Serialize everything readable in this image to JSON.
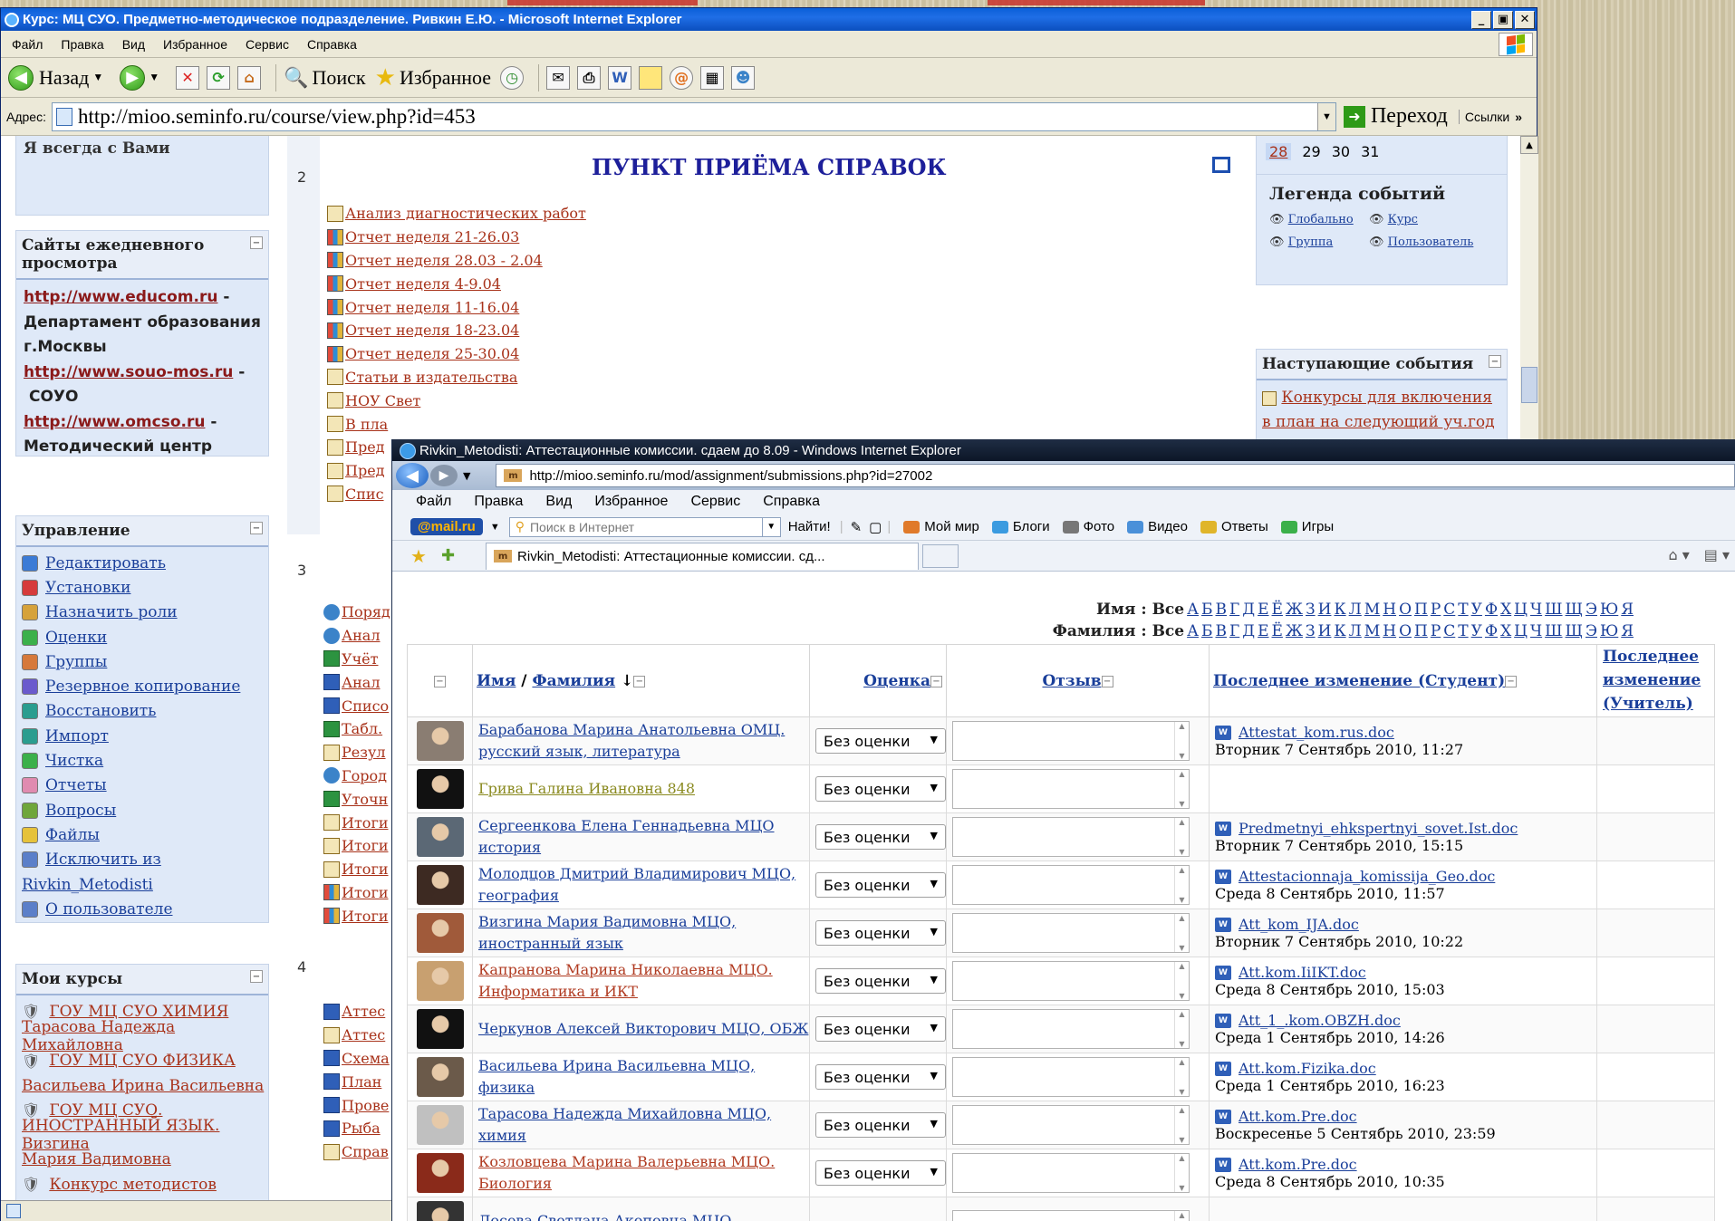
{
  "w1": {
    "title": "Курс: МЦ СУО. Предметно-методическое подразделение. Ривкин Е.Ю. - Microsoft Internet Explorer",
    "menu": [
      "Файл",
      "Правка",
      "Вид",
      "Избранное",
      "Сервис",
      "Справка"
    ],
    "toolbar": {
      "back": "Назад",
      "search": "Поиск",
      "favorites": "Избранное"
    },
    "address": {
      "label": "Адрес:",
      "url": "http://mioo.seminfo.ru/course/view.php?id=453",
      "go": "Переход",
      "links": "Ссылки"
    }
  },
  "left": {
    "always": "Я всегда с Вами",
    "sites": {
      "title": "Сайты ежедневного просмотра",
      "items": [
        {
          "link": "http://www.educom.ru",
          "suffix": " -"
        },
        {
          "text": "Департамент образования г.Москвы"
        },
        {
          "link": "http://www.souo-mos.ru",
          "suffix": " -"
        },
        {
          "text": "СОУО"
        },
        {
          "link": "http://www.omcso.ru",
          "suffix": " -"
        },
        {
          "text": "Методический центр"
        }
      ]
    },
    "admin": {
      "title": "Управление",
      "items": [
        "Редактировать",
        "Установки",
        "Назначить роли",
        "Оценки",
        "Группы",
        "Резервное копирование",
        "Восстановить",
        "Импорт",
        "Чистка",
        "Отчеты",
        "Вопросы",
        "Файлы",
        "Исключить из",
        "Rivkin_Metodisti",
        "О пользователе"
      ],
      "icon_colors": [
        "#3b7bd6",
        "#d63b3b",
        "#d6a23b",
        "#3bb04a",
        "#d6793b",
        "#6a5acd",
        "#2a9d8f",
        "#2a9d8f",
        "#3bb04a",
        "#e08bb0",
        "#6fa63b",
        "#e6c23b",
        "#5b7fc9",
        "",
        "#5b7fc9"
      ]
    },
    "courses": {
      "title": "Мои курсы",
      "items": [
        {
          "link": "ГОУ МЦ СУО ХИМИЯ",
          "icon": true
        },
        {
          "link": "Тарасова Надежда Михайловна"
        },
        {
          "link": "ГОУ МЦ СУО ФИЗИКА",
          "icon": true
        },
        {
          "link": "Васильева Ирина Васильевна"
        },
        {
          "link": "ГОУ МЦ СУО.",
          "icon": true
        },
        {
          "link": "ИНОСТРАННЫЙ ЯЗЫК. Визгина"
        },
        {
          "link": "Мария Вадимовна"
        },
        {
          "link": "Конкурс методистов",
          "icon": true
        }
      ]
    }
  },
  "center": {
    "sections": [
      "2",
      "3",
      "4"
    ],
    "heading": "ПУНКТ ПРИЁМА СПРАВОК",
    "sec2_links": [
      {
        "text": "Анализ диагностических работ",
        "icon": "doc"
      },
      {
        "text": "Отчет неделя 21-26.03",
        "icon": "xls"
      },
      {
        "text": "Отчет неделя 28.03 - 2.04",
        "icon": "xls"
      },
      {
        "text": "Отчет неделя 4-9.04",
        "icon": "xls"
      },
      {
        "text": "Отчет неделя 11-16.04",
        "icon": "xls"
      },
      {
        "text": "Отчет неделя 18-23.04",
        "icon": "xls"
      },
      {
        "text": "Отчет неделя 25-30.04",
        "icon": "xls"
      },
      {
        "text": "Статьи в издательства",
        "icon": "doc"
      },
      {
        "text": "НОУ Свет",
        "icon": "doc"
      },
      {
        "text": "В пла",
        "icon": "doc"
      },
      {
        "text": "Пред",
        "icon": "doc"
      },
      {
        "text": "Пред",
        "icon": "doc"
      },
      {
        "text": "Спис",
        "icon": "doc"
      }
    ],
    "sec3_links": [
      {
        "text": "Поряд",
        "icon": "quiz"
      },
      {
        "text": "Анал",
        "icon": "quiz"
      },
      {
        "text": "Учёт",
        "icon": "tbl"
      },
      {
        "text": "Анал",
        "icon": "word"
      },
      {
        "text": "Списо",
        "icon": "word"
      },
      {
        "text": "Табл.",
        "icon": "tbl"
      },
      {
        "text": "Резул",
        "icon": "doc"
      },
      {
        "text": "Город",
        "icon": "quiz"
      },
      {
        "text": "Уточн",
        "icon": "tbl"
      },
      {
        "text": "Итоги",
        "icon": "doc"
      },
      {
        "text": "Итоги",
        "icon": "doc"
      },
      {
        "text": "Итоги",
        "icon": "doc"
      },
      {
        "text": "Итоги",
        "icon": "xls"
      },
      {
        "text": "Итоги",
        "icon": "xls"
      }
    ],
    "sec4_links": [
      {
        "text": "Аттес",
        "icon": "word"
      },
      {
        "text": "Аттес",
        "icon": "doc"
      },
      {
        "text": "Схема",
        "icon": "word"
      },
      {
        "text": "План",
        "icon": "word"
      },
      {
        "text": "Прове",
        "icon": "word"
      },
      {
        "text": "Рыба",
        "icon": "word"
      },
      {
        "text": "Справ",
        "icon": "doc"
      }
    ]
  },
  "right": {
    "calendar_days": [
      "28",
      "29",
      "30",
      "31"
    ],
    "legend": {
      "title": "Легенда событий",
      "items": [
        "Глобально",
        "Курс",
        "Группа",
        "Пользователь"
      ]
    },
    "upcoming": {
      "title": "Наступающие события",
      "event": "Конкурсы для включения в план на следующий уч.год"
    }
  },
  "w2": {
    "title": "Rivkin_Metodisti: Аттестационные комиссии. сдаем до 8.09 - Windows Internet Explorer",
    "url": "http://mioo.seminfo.ru/mod/assignment/submissions.php?id=27002",
    "menu": [
      "Файл",
      "Правка",
      "Вид",
      "Избранное",
      "Сервис",
      "Справка"
    ],
    "mailru": "@mail.ru",
    "search_placeholder": "Поиск в Интернет",
    "find": "Найти!",
    "links": [
      "Мой мир",
      "Блоги",
      "Фото",
      "Видео",
      "Ответы",
      "Игры"
    ],
    "link_colors": [
      "#e07a2a",
      "#3b9be0",
      "#777777",
      "#4a90d9",
      "#e0b52a",
      "#3bb04a"
    ],
    "tab": "Rivkin_Metodisti: Аттестационные комиссии. сд...",
    "filter": {
      "first_label": "Имя : ",
      "last_label": "Фамилия : ",
      "all": "Все",
      "letters": [
        "А",
        "Б",
        "В",
        "Г",
        "Д",
        "Е",
        "Ё",
        "Ж",
        "З",
        "И",
        "К",
        "Л",
        "М",
        "Н",
        "О",
        "П",
        "Р",
        "С",
        "Т",
        "У",
        "Ф",
        "Х",
        "Ц",
        "Ч",
        "Ш",
        "Щ",
        "Э",
        "Ю",
        "Я"
      ]
    },
    "headers": {
      "first": "Имя",
      "slash": " / ",
      "last": "Фамилия",
      "grade": "Оценка",
      "comment": "Отзыв",
      "modified_student": "Последнее изменение (Студент)",
      "modified_teacher": "Последнее изменение (Учитель)"
    },
    "rows": [
      {
        "name": "Барабанова Марина Анатольевна ОМЦ. русский язык, литература",
        "color": "#1a3f9a",
        "avatar": "#8a7d72",
        "grade": "Без оценки",
        "file": "Attestat_kom.rus.doc",
        "date": "Вторник 7 Сентябрь 2010, 11:27"
      },
      {
        "name": "Грива Галина Ивановна 848",
        "color": "#8a8a20",
        "avatar": "#111111",
        "grade": "Без оценки",
        "file": "",
        "date": ""
      },
      {
        "name": "Сергеенкова Елена Геннадьевна МЦО история",
        "color": "#1a3f9a",
        "avatar": "#5b6875",
        "grade": "Без оценки",
        "file": "Predmetnyi_ehkspertnyi_sovet.Ist.doc",
        "date": "Вторник 7 Сентябрь 2010, 15:15"
      },
      {
        "name": "Молодцов Дмитрий Владимирович МЦО, география",
        "color": "#1a3f9a",
        "avatar": "#3d2a22",
        "grade": "Без оценки",
        "file": "Attestacionnaja_komissija_Geo.doc",
        "date": "Среда 8 Сентябрь 2010, 11:57"
      },
      {
        "name": "Визгина Мария Вадимовна МЦО, иностранный язык",
        "color": "#1a3f9a",
        "avatar": "#a05a3a",
        "grade": "Без оценки",
        "file": "Att_kom_IJA.doc",
        "date": "Вторник 7 Сентябрь 2010, 10:22"
      },
      {
        "name": "Капранова Марина Николаевна МЦО. Информатика и ИКТ",
        "color": "#b03a20",
        "avatar": "#c8a070",
        "grade": "Без оценки",
        "file": "Att.kom.IiIKT.doc",
        "date": "Среда 8 Сентябрь 2010, 15:03"
      },
      {
        "name": "Черкунов Алексей Викторович МЦО, ОБЖ",
        "color": "#1a3f9a",
        "avatar": "#111111",
        "grade": "Без оценки",
        "file": "Att_1_.kom.OBZH.doc",
        "date": "Среда 1 Сентябрь 2010, 14:26"
      },
      {
        "name": "Васильева Ирина Васильевна МЦО, физика",
        "color": "#1a3f9a",
        "avatar": "#6b5a4a",
        "grade": "Без оценки",
        "file": "Att.kom.Fizika.doc",
        "date": "Среда 1 Сентябрь 2010, 16:23"
      },
      {
        "name": "Тарасова Надежда Михайловна МЦО, химия",
        "color": "#1a3f9a",
        "avatar": "#c0c0c0",
        "grade": "Без оценки",
        "file": "Att.kom.Pre.doc",
        "date": "Воскресенье 5 Сентябрь 2010, 23:59"
      },
      {
        "name": "Козловцева Марина Валерьевна МЦО. Биология",
        "color": "#b03a20",
        "avatar": "#8a2a1a",
        "grade": "Без оценки",
        "file": "Att.kom.Pre.doc",
        "date": "Среда 8 Сентябрь 2010, 10:35"
      },
      {
        "name": "Лосева Светлана Акоповна МЦО,",
        "color": "#1a3f9a",
        "avatar": "#333333",
        "grade": "",
        "file": "",
        "date": ""
      }
    ]
  }
}
